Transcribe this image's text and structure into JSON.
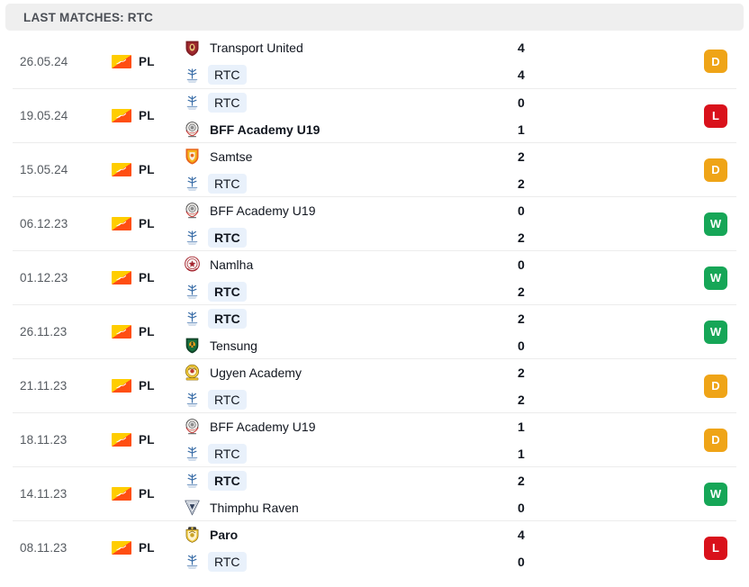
{
  "header": {
    "title": "LAST MATCHES: RTC"
  },
  "colors": {
    "win": "#16a657",
    "draw": "#efa417",
    "loss": "#d9111b",
    "highlight_pill": "#e9f1fb",
    "header_bar": "#efefef"
  },
  "league": {
    "code": "PL",
    "flag_icon": "bhutan-flag-icon"
  },
  "matches": [
    {
      "date": "26.05.24",
      "league": "PL",
      "home": {
        "name": "Transport United",
        "crest": "transport-united-crest",
        "score": "4",
        "bold": false,
        "highlight": false
      },
      "away": {
        "name": "RTC",
        "crest": "rtc-crest",
        "score": "4",
        "bold": false,
        "highlight": true
      },
      "result": "D"
    },
    {
      "date": "19.05.24",
      "league": "PL",
      "home": {
        "name": "RTC",
        "crest": "rtc-crest",
        "score": "0",
        "bold": false,
        "highlight": true
      },
      "away": {
        "name": "BFF Academy U19",
        "crest": "bff-academy-crest",
        "score": "1",
        "bold": true,
        "highlight": false
      },
      "result": "L"
    },
    {
      "date": "15.05.24",
      "league": "PL",
      "home": {
        "name": "Samtse",
        "crest": "samtse-crest",
        "score": "2",
        "bold": false,
        "highlight": false
      },
      "away": {
        "name": "RTC",
        "crest": "rtc-crest",
        "score": "2",
        "bold": false,
        "highlight": true
      },
      "result": "D"
    },
    {
      "date": "06.12.23",
      "league": "PL",
      "home": {
        "name": "BFF Academy U19",
        "crest": "bff-academy-crest",
        "score": "0",
        "bold": false,
        "highlight": false
      },
      "away": {
        "name": "RTC",
        "crest": "rtc-crest",
        "score": "2",
        "bold": true,
        "highlight": true
      },
      "result": "W"
    },
    {
      "date": "01.12.23",
      "league": "PL",
      "home": {
        "name": "Namlha",
        "crest": "namlha-crest",
        "score": "0",
        "bold": false,
        "highlight": false
      },
      "away": {
        "name": "RTC",
        "crest": "rtc-crest",
        "score": "2",
        "bold": true,
        "highlight": true
      },
      "result": "W"
    },
    {
      "date": "26.11.23",
      "league": "PL",
      "home": {
        "name": "RTC",
        "crest": "rtc-crest",
        "score": "2",
        "bold": true,
        "highlight": true
      },
      "away": {
        "name": "Tensung",
        "crest": "tensung-crest",
        "score": "0",
        "bold": false,
        "highlight": false
      },
      "result": "W"
    },
    {
      "date": "21.11.23",
      "league": "PL",
      "home": {
        "name": "Ugyen Academy",
        "crest": "ugyen-academy-crest",
        "score": "2",
        "bold": false,
        "highlight": false
      },
      "away": {
        "name": "RTC",
        "crest": "rtc-crest",
        "score": "2",
        "bold": false,
        "highlight": true
      },
      "result": "D"
    },
    {
      "date": "18.11.23",
      "league": "PL",
      "home": {
        "name": "BFF Academy U19",
        "crest": "bff-academy-crest",
        "score": "1",
        "bold": false,
        "highlight": false
      },
      "away": {
        "name": "RTC",
        "crest": "rtc-crest",
        "score": "1",
        "bold": false,
        "highlight": true
      },
      "result": "D"
    },
    {
      "date": "14.11.23",
      "league": "PL",
      "home": {
        "name": "RTC",
        "crest": "rtc-crest",
        "score": "2",
        "bold": true,
        "highlight": true
      },
      "away": {
        "name": "Thimphu Raven",
        "crest": "thimphu-raven-crest",
        "score": "0",
        "bold": false,
        "highlight": false
      },
      "result": "W"
    },
    {
      "date": "08.11.23",
      "league": "PL",
      "home": {
        "name": "Paro",
        "crest": "paro-crest",
        "score": "4",
        "bold": true,
        "highlight": false
      },
      "away": {
        "name": "RTC",
        "crest": "rtc-crest",
        "score": "0",
        "bold": false,
        "highlight": true
      },
      "result": "L"
    }
  ]
}
